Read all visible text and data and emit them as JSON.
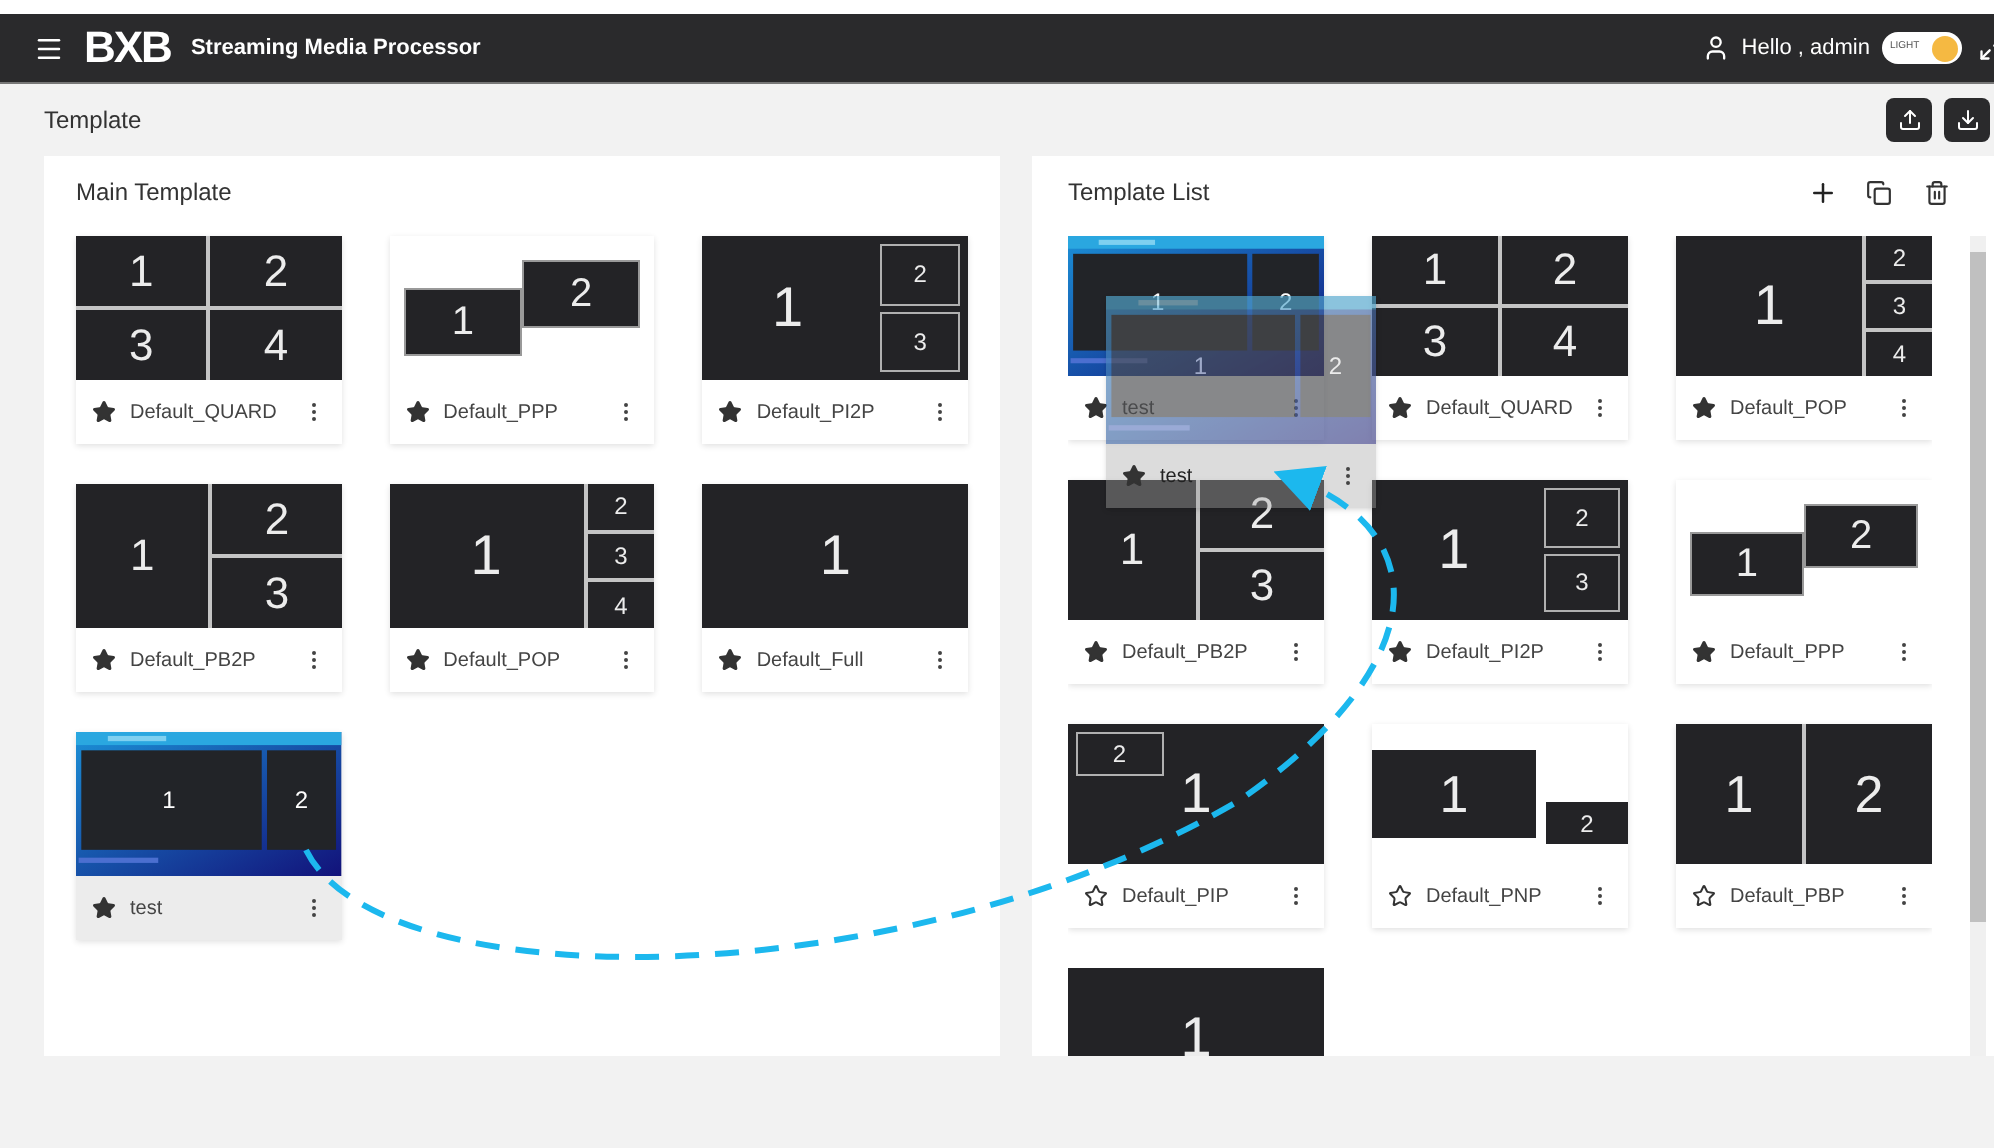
{
  "header": {
    "logo": "BXB",
    "app_title": "Streaming Media Processor",
    "greeting": "Hello , admin",
    "theme_toggle": {
      "label": "LIGHT",
      "on": true
    }
  },
  "page_title": "Template",
  "main_template": {
    "title": "Main Template",
    "cards": [
      {
        "name": "Default_QUARD",
        "kind": "quard",
        "cells": [
          "1",
          "2",
          "3",
          "4"
        ],
        "starred": true,
        "selected": false
      },
      {
        "name": "Default_PPP",
        "kind": "ppp",
        "cells": [
          "1",
          "2"
        ],
        "starred": true,
        "selected": false
      },
      {
        "name": "Default_PI2P",
        "kind": "pi2p",
        "cells": [
          "1",
          "2",
          "3"
        ],
        "starred": true,
        "selected": false
      },
      {
        "name": "Default_PB2P",
        "kind": "pb2p",
        "cells": [
          "1",
          "2",
          "3"
        ],
        "starred": true,
        "selected": false
      },
      {
        "name": "Default_POP",
        "kind": "pop",
        "cells": [
          "1",
          "2",
          "3",
          "4"
        ],
        "starred": true,
        "selected": false
      },
      {
        "name": "Default_Full",
        "kind": "full",
        "cells": [
          "1"
        ],
        "starred": true,
        "selected": false
      },
      {
        "name": "test",
        "kind": "custom",
        "cells": [
          "1",
          "2"
        ],
        "starred": true,
        "selected": true
      }
    ]
  },
  "template_list": {
    "title": "Template List",
    "cards": [
      {
        "name": "test",
        "kind": "custom",
        "cells": [
          "1",
          "2"
        ],
        "starred": true,
        "selected": false
      },
      {
        "name": "Default_QUARD",
        "kind": "quard",
        "cells": [
          "1",
          "2",
          "3",
          "4"
        ],
        "starred": true,
        "selected": false
      },
      {
        "name": "Default_POP",
        "kind": "pop",
        "cells": [
          "1",
          "2",
          "3",
          "4"
        ],
        "starred": true,
        "selected": false
      },
      {
        "name": "Default_PB2P",
        "kind": "pb2p",
        "cells": [
          "1",
          "2",
          "3"
        ],
        "starred": true,
        "selected": false
      },
      {
        "name": "Default_PI2P",
        "kind": "pi2p",
        "cells": [
          "1",
          "2",
          "3"
        ],
        "starred": true,
        "selected": false
      },
      {
        "name": "Default_PPP",
        "kind": "ppp",
        "cells": [
          "1",
          "2"
        ],
        "starred": true,
        "selected": false
      },
      {
        "name": "Default_PIP",
        "kind": "pip",
        "cells": [
          "1",
          "2"
        ],
        "starred": false,
        "selected": false
      },
      {
        "name": "Default_PNP",
        "kind": "pnp",
        "cells": [
          "1",
          "2"
        ],
        "starred": false,
        "selected": false
      },
      {
        "name": "Default_PBP",
        "kind": "pbp",
        "cells": [
          "1",
          "2"
        ],
        "starred": false,
        "selected": false
      },
      {
        "kind": "full",
        "cells": [
          "1"
        ]
      }
    ]
  },
  "drag_preview": {
    "name": "test",
    "kind": "custom",
    "cells": [
      "1",
      "2"
    ],
    "starred": true
  }
}
